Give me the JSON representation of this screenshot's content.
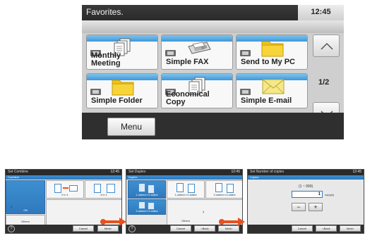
{
  "main": {
    "title": "Favorites.",
    "time": "12:45",
    "tiles": [
      {
        "label": "Monthly\nMeeting",
        "icon": "document-stack-icon"
      },
      {
        "label": "Simple FAX",
        "icon": "fax-machine-icon"
      },
      {
        "label": "Send to My PC",
        "icon": "folder-icon"
      },
      {
        "label": "Simple Folder",
        "icon": "folder-icon"
      },
      {
        "label": "Economical\nCopy",
        "icon": "document-stack-icon"
      },
      {
        "label": "Simple E-mail",
        "icon": "envelope-icon"
      }
    ],
    "page_indicator": "1/2",
    "menu_label": "Menu"
  },
  "panel1": {
    "title": "Set Combine",
    "subtitle": "Combine",
    "time": "12:45",
    "options": [
      "Off",
      "2 in 1",
      "4 in 1"
    ],
    "others": "Others",
    "buttons": [
      "Cancel",
      "Next>"
    ]
  },
  "panel2": {
    "title": "Set Duplex",
    "subtitle": "Duplex",
    "time": "12:45",
    "options": [
      "1-sided>>1-sided",
      "1-sided>>2-sided",
      "2-sided>>2-sided",
      "2-sided>>1-sided"
    ],
    "others": "Others",
    "buttons": [
      "Cancel",
      "<Back",
      "Next>"
    ]
  },
  "panel3": {
    "title": "Set Number of copies",
    "subtitle": "Copies",
    "time": "12:45",
    "range": "(1 ~ 999)",
    "value": "1",
    "unit": "copy(s)",
    "minus": "−",
    "plus": "+",
    "buttons": [
      "Cancel",
      "<Back",
      "Next>"
    ]
  },
  "colors": {
    "accent_blue": "#3e97d7",
    "arrow_orange": "#e8501f",
    "folder_yellow": "#f2c417"
  }
}
